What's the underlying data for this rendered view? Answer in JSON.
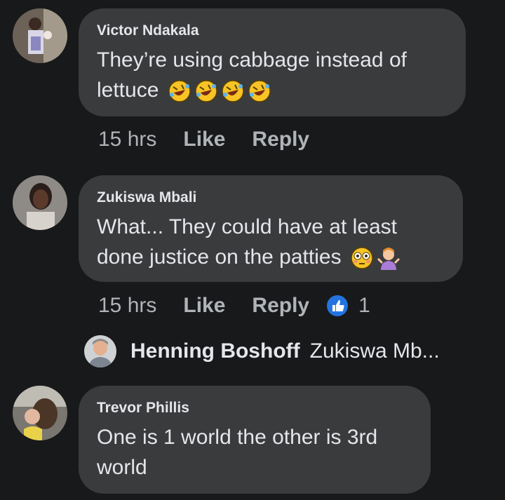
{
  "comments": [
    {
      "author": "Victor Ndakala",
      "line1": "They’re using cabbage instead of",
      "line2": "lettuce",
      "time": "15 hrs",
      "like_label": "Like",
      "reply_label": "Reply",
      "emoji": [
        "rofl-emoji",
        "rofl-emoji",
        "rofl-emoji",
        "rofl-emoji"
      ]
    },
    {
      "author": "Zukiswa Mbali",
      "line1": "What... They could have at least",
      "line2": "done justice on the patties",
      "time": "15 hrs",
      "like_label": "Like",
      "reply_label": "Reply",
      "reaction_count": "1",
      "emoji": [
        "flushed-emoji",
        "person-shrugging-emoji"
      ]
    },
    {
      "author": "Trevor Phillis",
      "line1": "One is 1 world the other is 3rd",
      "line2": "world"
    }
  ],
  "reply_preview": {
    "author": "Henning Boshoff",
    "text": "Zukiswa Mb..."
  },
  "colors": {
    "background": "#18191a",
    "bubble": "#3a3b3c",
    "text": "#e4e6eb",
    "secondary": "#b0b3b8",
    "like_blue": "#2374e1"
  }
}
